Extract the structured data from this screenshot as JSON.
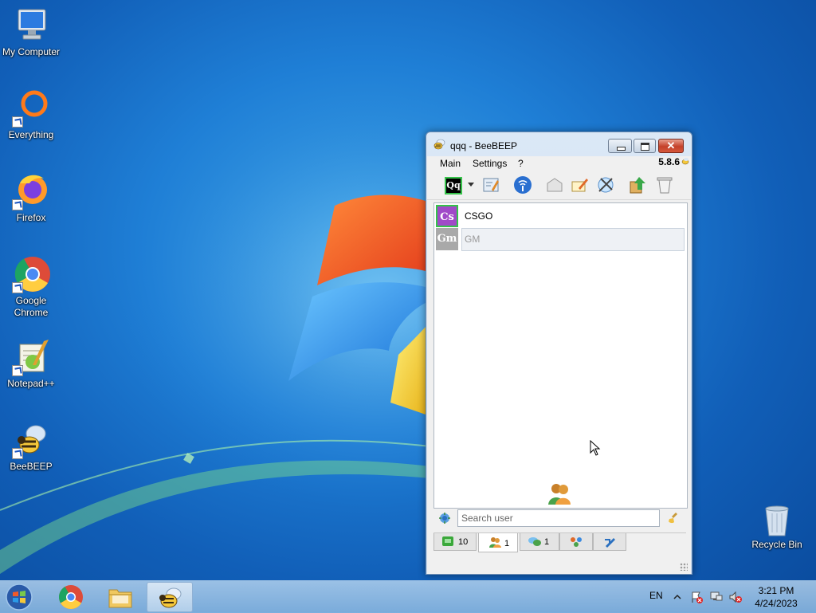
{
  "desktop": {
    "icons": [
      {
        "label": "My Computer"
      },
      {
        "label": "Everything"
      },
      {
        "label": "Firefox"
      },
      {
        "label": "Google Chrome"
      },
      {
        "label": "Notepad++"
      },
      {
        "label": "BeeBEEP"
      },
      {
        "label": "Recycle Bin"
      }
    ]
  },
  "window": {
    "title": "qqq - BeeBEEP",
    "close_glyph": "✕",
    "menu": [
      "Main",
      "Settings",
      "?"
    ],
    "version": "5.8.6",
    "status_button_label": "Qq",
    "users": [
      {
        "initials": "Cs",
        "name": "CSGO",
        "color": "#a04ac8"
      },
      {
        "initials": "Gm",
        "name": "GM",
        "color": "#a9a9a9"
      }
    ],
    "search": {
      "placeholder": "Search user"
    },
    "tabs": [
      {
        "count": "10"
      },
      {
        "count": "1"
      },
      {
        "count": "1"
      },
      {
        "count": ""
      },
      {
        "count": ""
      }
    ]
  },
  "taskbar": {
    "lang": "EN",
    "time": "3:21 PM",
    "date": "4/24/2023"
  }
}
